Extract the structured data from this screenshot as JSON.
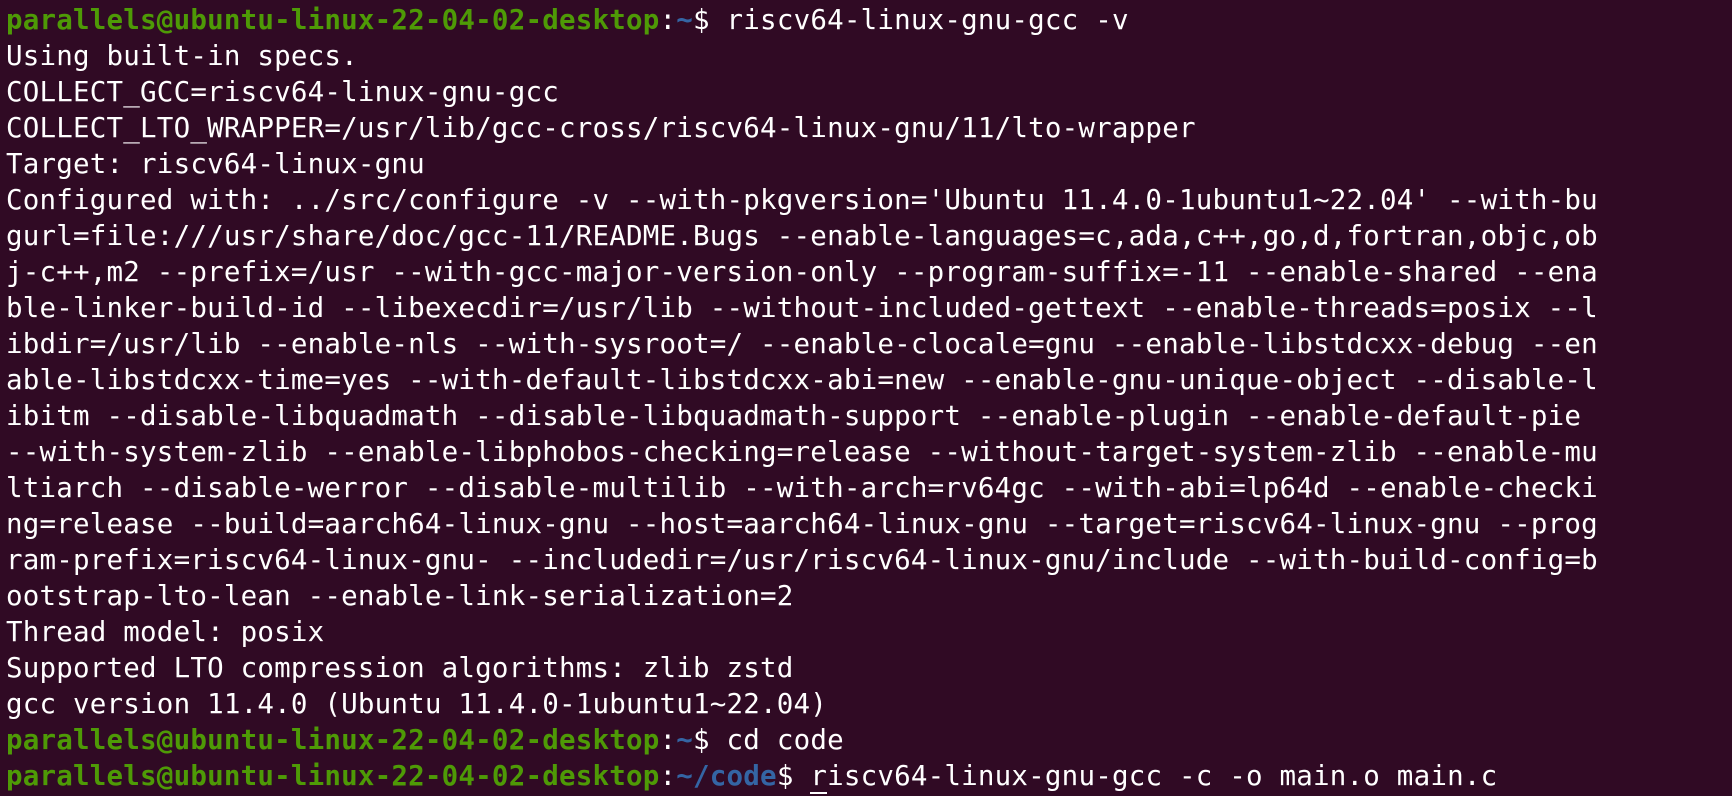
{
  "terminal": {
    "prompt_user_host": "parallels@ubuntu-linux-22-04-02-desktop",
    "prompt_colon": ":",
    "prompt_dollar": "$ ",
    "lines": [
      {
        "type": "prompt",
        "path": "~",
        "command": "riscv64-linux-gnu-gcc -v"
      },
      {
        "type": "output",
        "text": "Using built-in specs."
      },
      {
        "type": "output",
        "text": "COLLECT_GCC=riscv64-linux-gnu-gcc"
      },
      {
        "type": "output",
        "text": "COLLECT_LTO_WRAPPER=/usr/lib/gcc-cross/riscv64-linux-gnu/11/lto-wrapper"
      },
      {
        "type": "output",
        "text": "Target: riscv64-linux-gnu"
      },
      {
        "type": "output",
        "text": "Configured with: ../src/configure -v --with-pkgversion='Ubuntu 11.4.0-1ubuntu1~22.04' --with-bu"
      },
      {
        "type": "output",
        "text": "gurl=file:///usr/share/doc/gcc-11/README.Bugs --enable-languages=c,ada,c++,go,d,fortran,objc,ob"
      },
      {
        "type": "output",
        "text": "j-c++,m2 --prefix=/usr --with-gcc-major-version-only --program-suffix=-11 --enable-shared --ena"
      },
      {
        "type": "output",
        "text": "ble-linker-build-id --libexecdir=/usr/lib --without-included-gettext --enable-threads=posix --l"
      },
      {
        "type": "output",
        "text": "ibdir=/usr/lib --enable-nls --with-sysroot=/ --enable-clocale=gnu --enable-libstdcxx-debug --en"
      },
      {
        "type": "output",
        "text": "able-libstdcxx-time=yes --with-default-libstdcxx-abi=new --enable-gnu-unique-object --disable-l"
      },
      {
        "type": "output",
        "text": "ibitm --disable-libquadmath --disable-libquadmath-support --enable-plugin --enable-default-pie"
      },
      {
        "type": "output",
        "text": "--with-system-zlib --enable-libphobos-checking=release --without-target-system-zlib --enable-mu"
      },
      {
        "type": "output",
        "text": "ltiarch --disable-werror --disable-multilib --with-arch=rv64gc --with-abi=lp64d --enable-checki"
      },
      {
        "type": "output",
        "text": "ng=release --build=aarch64-linux-gnu --host=aarch64-linux-gnu --target=riscv64-linux-gnu --prog"
      },
      {
        "type": "output",
        "text": "ram-prefix=riscv64-linux-gnu- --includedir=/usr/riscv64-linux-gnu/include --with-build-config=b"
      },
      {
        "type": "output",
        "text": "ootstrap-lto-lean --enable-link-serialization=2"
      },
      {
        "type": "output",
        "text": "Thread model: posix"
      },
      {
        "type": "output",
        "text": "Supported LTO compression algorithms: zlib zstd"
      },
      {
        "type": "output",
        "text": "gcc version 11.4.0 (Ubuntu 11.4.0-1ubuntu1~22.04)"
      },
      {
        "type": "prompt",
        "path": "~",
        "command": "cd code"
      },
      {
        "type": "prompt",
        "path": "~/code",
        "command": "riscv64-linux-gnu-gcc -c -o main.o main.c",
        "active": true
      }
    ]
  },
  "colors": {
    "background": "#300a24",
    "prompt_user_host": "#4e9a06",
    "prompt_path": "#3465a4",
    "text": "#ffffff"
  }
}
